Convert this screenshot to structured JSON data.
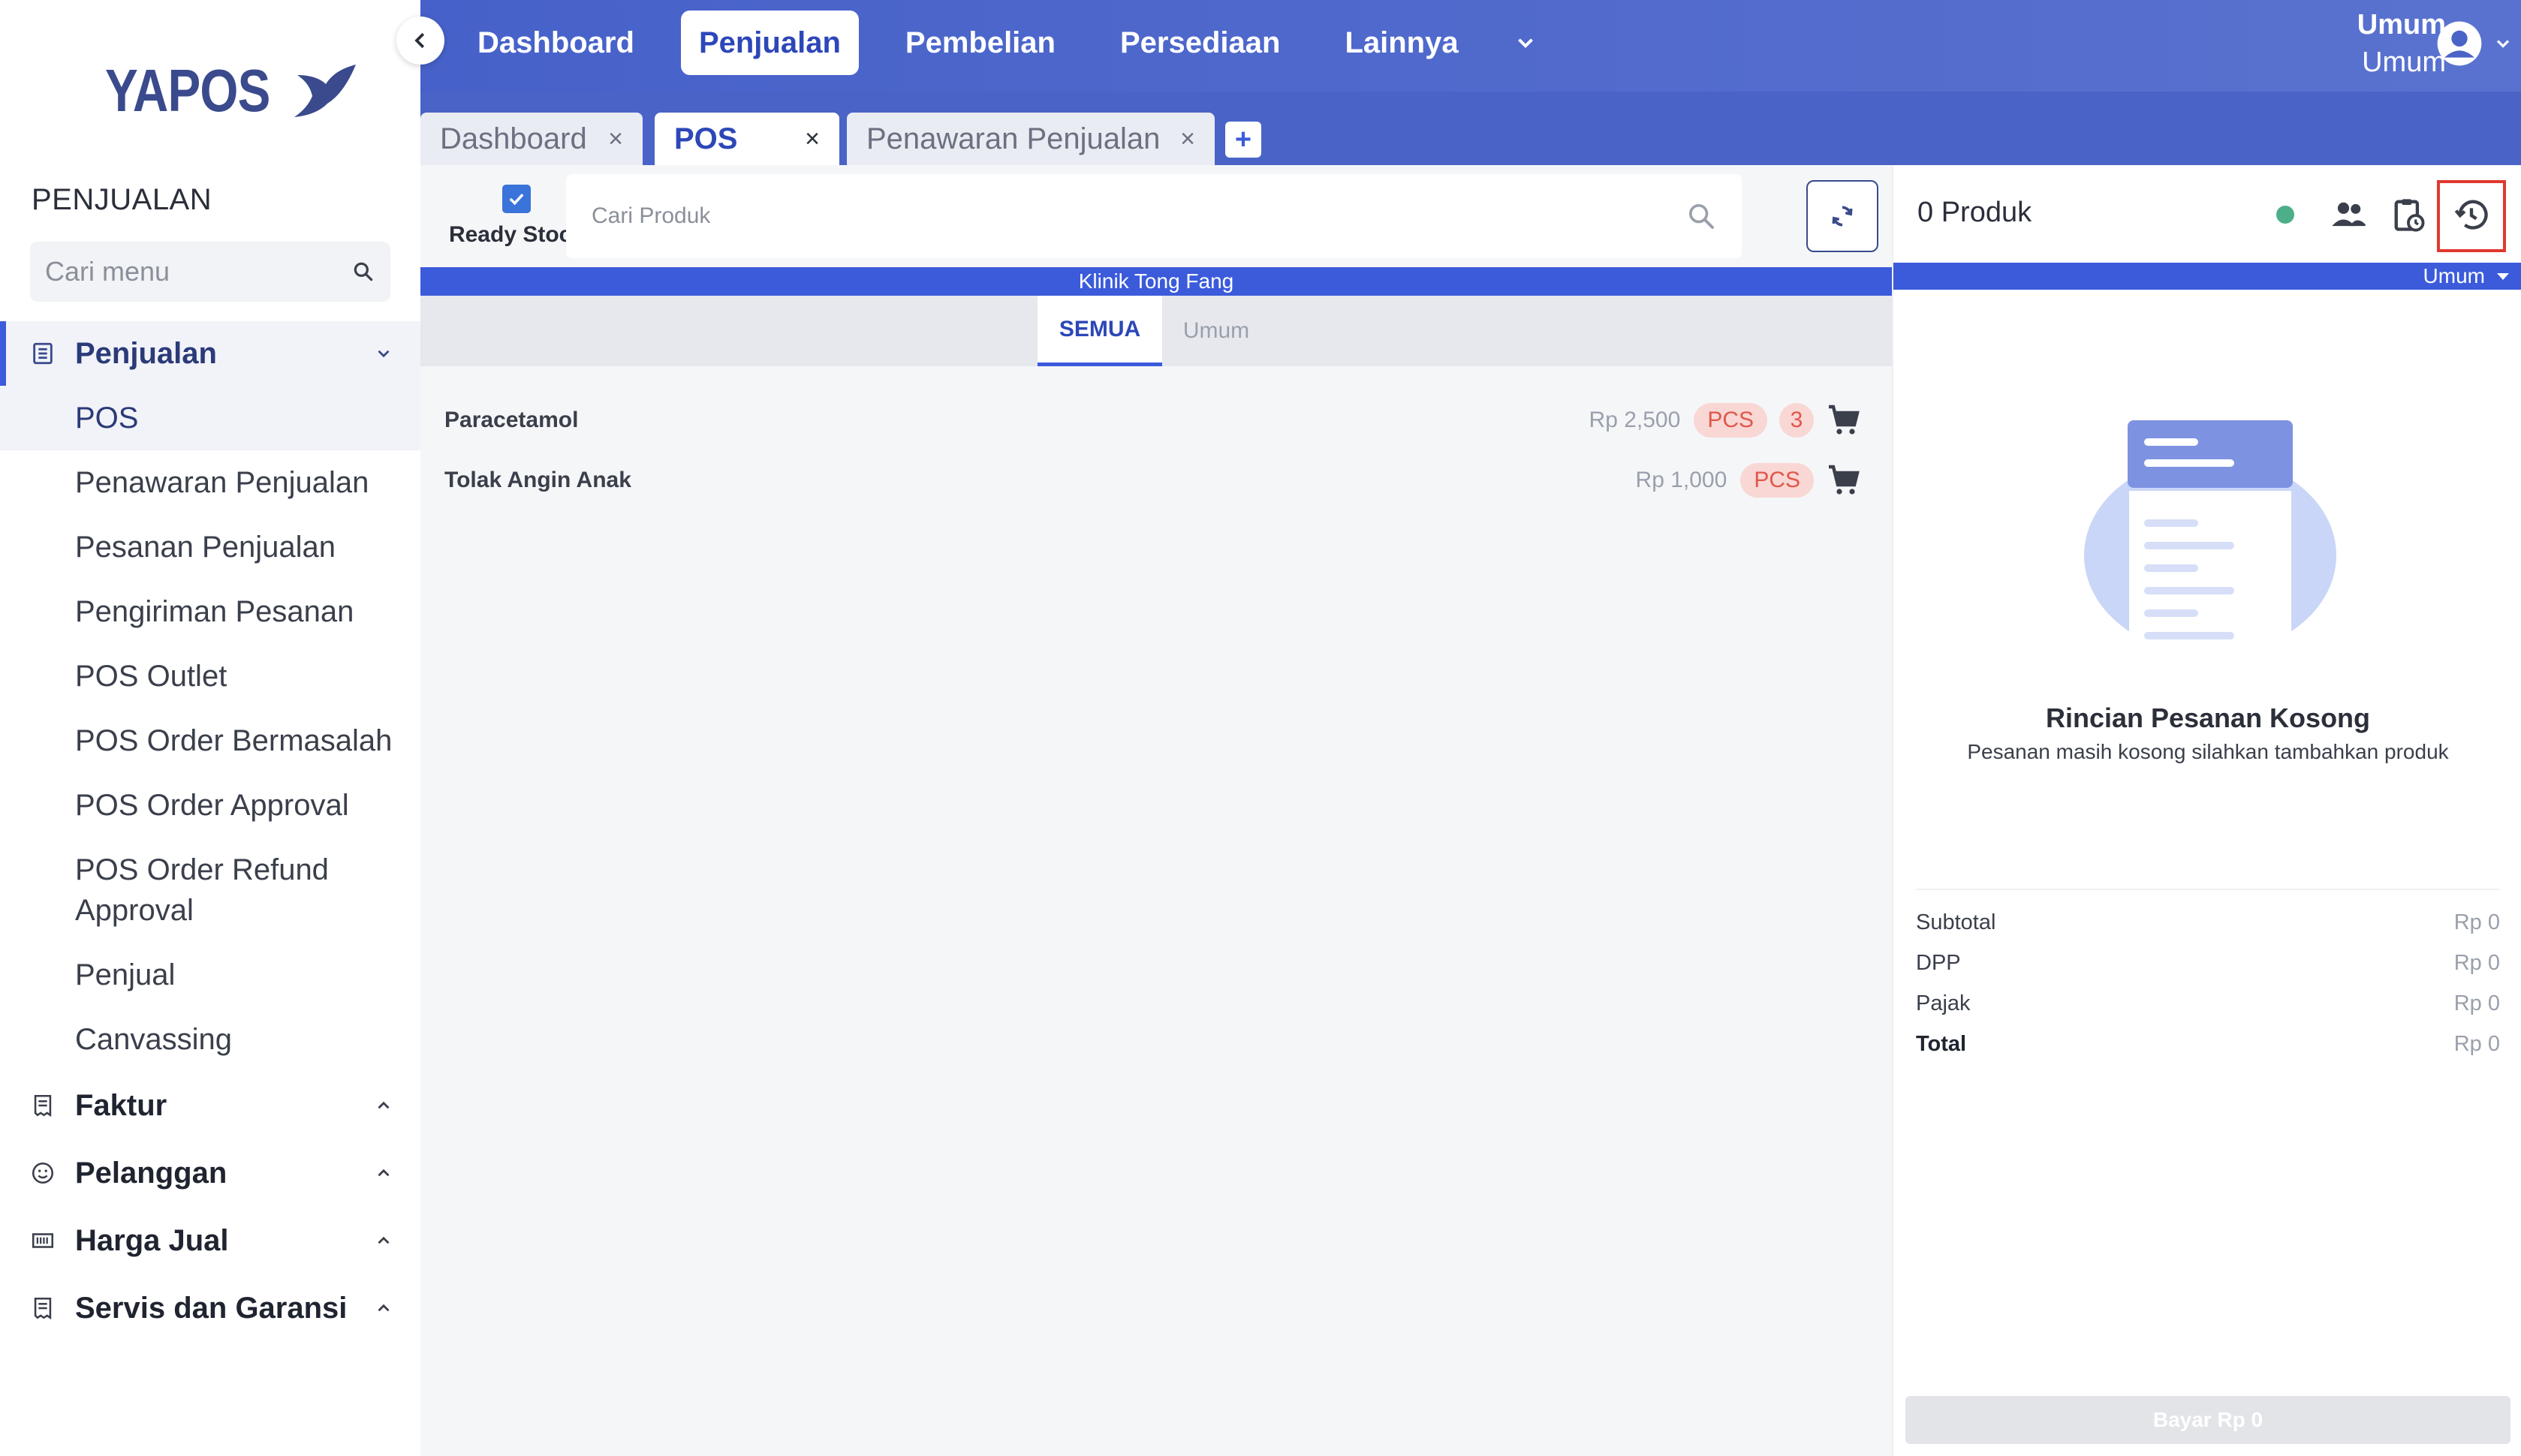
{
  "brand": {
    "name": "YAPOS"
  },
  "sidebar": {
    "section_title": "PENJUALAN",
    "search_placeholder": "Cari menu",
    "groups": [
      {
        "label": "Penjualan",
        "icon": "document-list-icon",
        "expanded": true,
        "items": [
          "POS",
          "Penawaran Penjualan",
          "Pesanan Penjualan",
          "Pengiriman Pesanan",
          "POS Outlet",
          "POS Order Bermasalah",
          "POS Order Approval",
          "POS Order Refund Approval",
          "Penjual",
          "Canvassing"
        ],
        "active_item": "POS"
      },
      {
        "label": "Faktur",
        "icon": "receipt-icon"
      },
      {
        "label": "Pelanggan",
        "icon": "smile-icon"
      },
      {
        "label": "Harga Jual",
        "icon": "barcode-icon"
      },
      {
        "label": "Servis dan Garansi",
        "icon": "receipt-icon"
      }
    ]
  },
  "topnav": {
    "items": [
      "Dashboard",
      "Penjualan",
      "Pembelian",
      "Persediaan",
      "Lainnya"
    ],
    "active": "Penjualan"
  },
  "user": {
    "line1": "Umum",
    "line2": "Umum"
  },
  "tabs": [
    {
      "label": "Dashboard",
      "close": "×"
    },
    {
      "label": "POS",
      "close": "×",
      "active": true
    },
    {
      "label": "Penawaran Penjualan",
      "close": "×"
    }
  ],
  "tab_add": "+",
  "pos": {
    "ready_stock_label": "Ready Stock",
    "ready_stock_checked": true,
    "search_placeholder": "Cari Produk",
    "outlet_name": "Klinik Tong Fang",
    "categories": [
      "SEMUA",
      "Umum"
    ],
    "active_category": "SEMUA",
    "products": [
      {
        "name": "Paracetamol",
        "price": "Rp 2,500",
        "unit": "PCS",
        "qty": "3"
      },
      {
        "name": "Tolak Angin Anak",
        "price": "Rp 1,000",
        "unit": "PCS"
      }
    ]
  },
  "order": {
    "count_label": "0 Produk",
    "status_color": "#4caf8a",
    "customer": "Umum",
    "empty_title": "Rincian Pesanan Kosong",
    "empty_subtitle": "Pesanan masih kosong silahkan tambahkan produk",
    "totals": [
      {
        "label": "Subtotal",
        "value": "Rp 0"
      },
      {
        "label": "DPP",
        "value": "Rp 0"
      },
      {
        "label": "Pajak",
        "value": "Rp 0"
      },
      {
        "label": "Total",
        "value": "Rp 0"
      }
    ],
    "pay_label": "Bayar Rp 0"
  },
  "colors": {
    "accent": "#3b5bdb",
    "topbar": "#4a63c7",
    "highlight": "#e0392f"
  }
}
